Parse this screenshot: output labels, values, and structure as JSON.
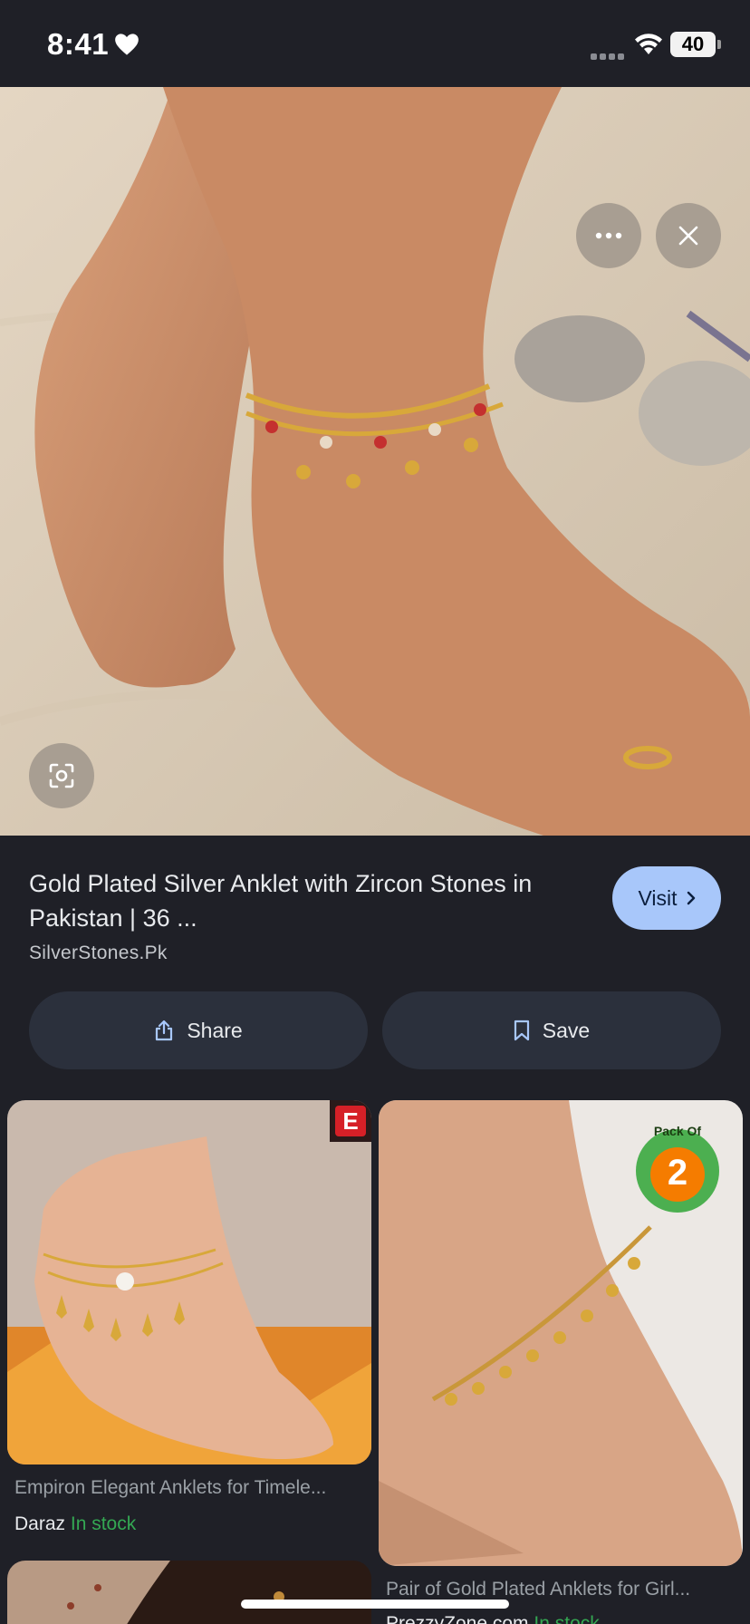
{
  "status_bar": {
    "time": "8:41",
    "battery": "40"
  },
  "result": {
    "title": "Gold Plated Silver Anklet with Zircon Stones in Pakistan | 36 ...",
    "source": "SilverStones.Pk",
    "visit_label": "Visit"
  },
  "actions": {
    "share_label": "Share",
    "save_label": "Save"
  },
  "related": [
    {
      "title": "Empiron Elegant Anklets for Timele...",
      "merchant": "Daraz",
      "stock": "In stock",
      "badge": "E"
    },
    {
      "title": "Pair of Gold Plated Anklets for Girl...",
      "merchant": "PrezzyZone.com",
      "stock": "In stock",
      "badge_top": "Pack Of",
      "badge_num": "2"
    }
  ],
  "colors": {
    "accent": "#a8c7fa",
    "background": "#1f2027",
    "stock": "#34a853"
  }
}
